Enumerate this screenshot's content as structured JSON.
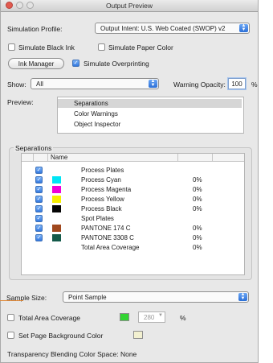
{
  "window": {
    "title": "Output Preview"
  },
  "simulation": {
    "label": "Simulation Profile:",
    "profile": "Output Intent: U.S. Web Coated (SWOP) v2",
    "simulate_black_ink": {
      "label": "Simulate Black Ink",
      "checked": false
    },
    "simulate_paper_color": {
      "label": "Simulate Paper Color",
      "checked": false
    },
    "ink_manager_label": "Ink Manager",
    "simulate_overprinting": {
      "label": "Simulate Overprinting",
      "checked": true
    }
  },
  "show": {
    "label": "Show:",
    "value": "All"
  },
  "warning_opacity": {
    "label": "Warning Opacity:",
    "value": "100",
    "unit": "%"
  },
  "preview": {
    "label": "Preview:",
    "items": [
      "Separations",
      "Color Warnings",
      "Object Inspector"
    ],
    "selected": "Separations"
  },
  "separations": {
    "group_label": "Separations",
    "column_name": "Name",
    "rows": [
      {
        "checked": true,
        "swatch": "",
        "name": "Process Plates",
        "percent": ""
      },
      {
        "checked": true,
        "swatch": "#00e5f5",
        "name": "Process Cyan",
        "percent": "0%"
      },
      {
        "checked": true,
        "swatch": "#f000d8",
        "name": "Process Magenta",
        "percent": "0%"
      },
      {
        "checked": true,
        "swatch": "#f7ef00",
        "name": "Process Yellow",
        "percent": "0%"
      },
      {
        "checked": true,
        "swatch": "#050505",
        "name": "Process Black",
        "percent": "0%"
      },
      {
        "checked": true,
        "swatch": "",
        "name": "Spot Plates",
        "percent": ""
      },
      {
        "checked": true,
        "swatch": "#a0481e",
        "name": "PANTONE 174 C",
        "percent": "0%"
      },
      {
        "checked": true,
        "swatch": "#145a4a",
        "name": "PANTONE 3308 C",
        "percent": "0%"
      },
      {
        "checked": false,
        "swatch": "",
        "name": "Total Area Coverage",
        "percent": "0%"
      }
    ]
  },
  "sample_size": {
    "label": "Sample Size:",
    "value": "Point Sample"
  },
  "total_area_coverage": {
    "label": "Total Area Coverage",
    "checked": false,
    "color": "#33d433",
    "value": "280",
    "unit": "%"
  },
  "page_background": {
    "label": "Set Page Background Color",
    "checked": false,
    "color": "#f2f0d0"
  },
  "transparency": {
    "text": "Transparency Blending Color Space:  None"
  }
}
